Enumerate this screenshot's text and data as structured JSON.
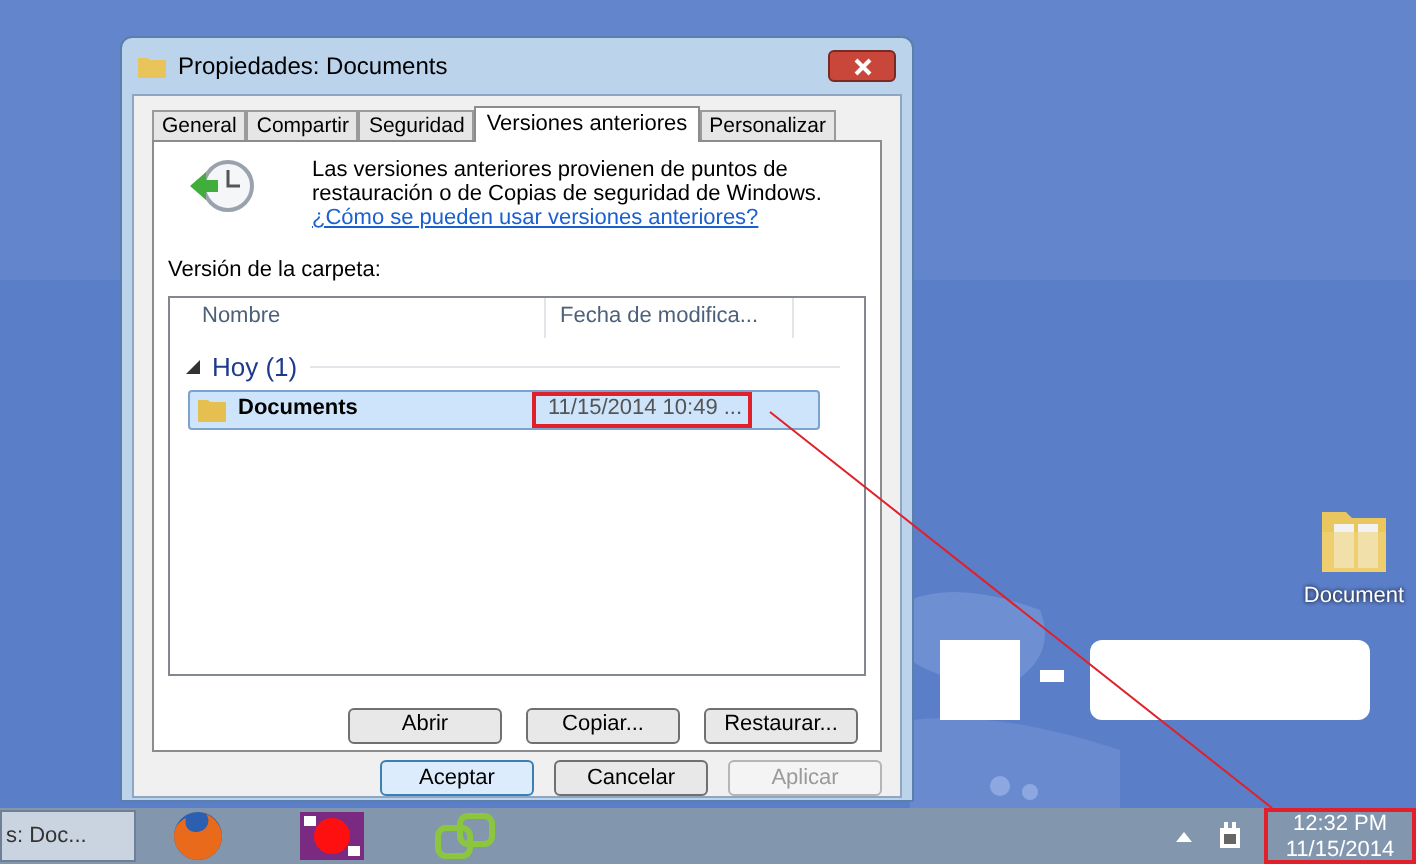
{
  "window": {
    "title": "Propiedades: Documents"
  },
  "tabs": [
    {
      "label": "General",
      "selected": false
    },
    {
      "label": "Compartir",
      "selected": false
    },
    {
      "label": "Seguridad",
      "selected": false
    },
    {
      "label": "Versiones anteriores",
      "selected": true
    },
    {
      "label": "Personalizar",
      "selected": false
    }
  ],
  "info": {
    "text": "Las versiones anteriores provienen de puntos de restauración o de Copias de seguridad de Windows.",
    "link": "¿Cómo se pueden usar versiones anteriores?"
  },
  "list_label": "Versión de la carpeta:",
  "columns": [
    "Nombre",
    "Fecha de modifica..."
  ],
  "groups": [
    {
      "label": "Hoy (1)",
      "expanded": true,
      "rows": [
        {
          "name": "Documents",
          "date": "11/15/2014 10:49 ...",
          "selected": true,
          "highlighted": true
        }
      ]
    }
  ],
  "actions": [
    {
      "label": "Abrir",
      "disabled": false
    },
    {
      "label": "Copiar...",
      "disabled": false
    },
    {
      "label": "Restaurar...",
      "disabled": false
    }
  ],
  "footer_buttons": [
    {
      "label": "Aceptar",
      "default": true,
      "disabled": false
    },
    {
      "label": "Cancelar",
      "default": false,
      "disabled": false
    },
    {
      "label": "Aplicar",
      "default": false,
      "disabled": true
    }
  ],
  "desktop_icons": [
    {
      "label": "Document"
    }
  ],
  "taskbar": {
    "window_button": "s: Doc...",
    "clock": {
      "time": "12:32 PM",
      "date": "11/15/2014",
      "highlighted": true
    }
  }
}
